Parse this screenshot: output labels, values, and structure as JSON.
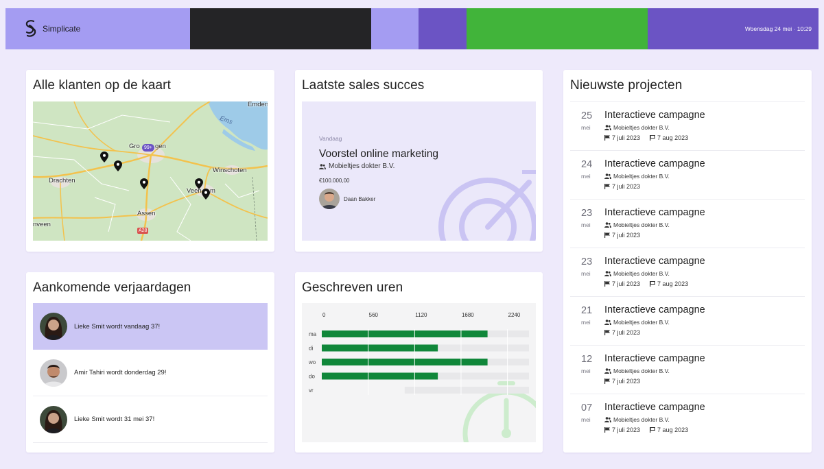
{
  "header": {
    "logo_text": "Simplicate",
    "datetime": "Woensdag 24 mei · 10:29",
    "colors": [
      "#a49cf2",
      "#242426",
      "#a49cf2",
      "#6b54c4",
      "#41b43a",
      "#6b54c4"
    ]
  },
  "map_card": {
    "title": "Alle klanten op de kaart",
    "labels": {
      "emden": "Emden",
      "ems": "Ems",
      "groningen_left": "Gro",
      "groningen_right": "gen",
      "winschoten": "Winschoten",
      "drachten": "Drachten",
      "veendam_left": "Veen",
      "veendam_right": "m",
      "assen": "Assen",
      "heerenveen": "nveen",
      "road": "A28"
    },
    "cluster_count": "99+",
    "pin_icon": "map-pin-icon"
  },
  "sales_card": {
    "title": "Laatste sales succes",
    "date": "Vandaag",
    "deal": "Voorstel online marketing",
    "client": "Mobieltjes dokter B.V.",
    "amount": "€100.000,00",
    "person": "Daan Bakker"
  },
  "projects_card": {
    "title": "Nieuwste projecten",
    "items": [
      {
        "day": "25",
        "month": "mei",
        "title": "Interactieve campagne",
        "client": "Mobieltjes dokter B.V.",
        "start": "7 juli 2023",
        "end": "7 aug 2023"
      },
      {
        "day": "24",
        "month": "mei",
        "title": "Interactieve campagne",
        "client": "Mobieltjes dokter B.V.",
        "start": "7 juli 2023",
        "end": ""
      },
      {
        "day": "23",
        "month": "mei",
        "title": "Interactieve campagne",
        "client": "Mobieltjes dokter B.V.",
        "start": "7 juli 2023",
        "end": ""
      },
      {
        "day": "23",
        "month": "mei",
        "title": "Interactieve campagne",
        "client": "Mobieltjes dokter B.V.",
        "start": "7 juli 2023",
        "end": "7 aug 2023"
      },
      {
        "day": "21",
        "month": "mei",
        "title": "Interactieve campagne",
        "client": "Mobieltjes dokter B.V.",
        "start": "7 juli 2023",
        "end": ""
      },
      {
        "day": "12",
        "month": "mei",
        "title": "Interactieve campagne",
        "client": "Mobieltjes dokter B.V.",
        "start": "7 juli 2023",
        "end": ""
      },
      {
        "day": "07",
        "month": "mei",
        "title": "Interactieve campagne",
        "client": "Mobieltjes dokter B.V.",
        "start": "7 juli 2023",
        "end": "7 aug 2023"
      }
    ]
  },
  "birthday_card": {
    "title": "Aankomende verjaardagen",
    "items": [
      {
        "text": "Lieke Smit wordt vandaag 37!",
        "highlighted": true
      },
      {
        "text": "Amir Tahiri wordt donderdag 29!",
        "highlighted": false
      },
      {
        "text": "Lieke Smit wordt 31 mei 37!",
        "highlighted": false
      }
    ]
  },
  "hours_card": {
    "title": "Geschreven uren"
  },
  "chart_data": {
    "type": "bar",
    "orientation": "horizontal",
    "categories": [
      "ma",
      "di",
      "wo",
      "do",
      "vr"
    ],
    "values": [
      2000,
      1400,
      2000,
      1400,
      0
    ],
    "target": [
      2500,
      2500,
      2500,
      2500,
      2500
    ],
    "target_start": [
      0,
      0,
      0,
      0,
      1000
    ],
    "xticks": [
      0,
      560,
      1120,
      1680,
      2240
    ],
    "xlim": [
      0,
      2500
    ],
    "colors": {
      "bar": "#10873a",
      "track": "#e8e8ea"
    }
  }
}
